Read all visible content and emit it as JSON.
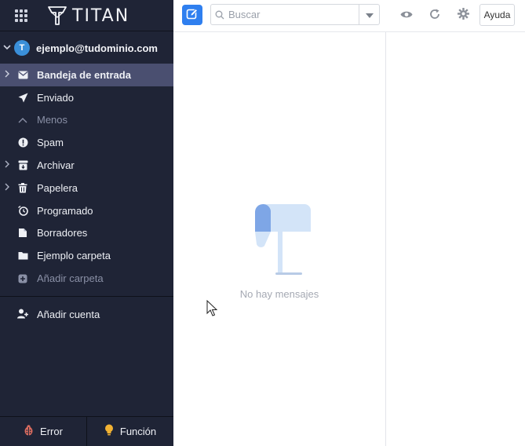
{
  "app": {
    "logo_text": "TITAN"
  },
  "account": {
    "initial": "T",
    "email": "ejemplo@tudominio.com"
  },
  "folders": [
    {
      "label": "Bandeja de entrada",
      "icon": "envelope-icon"
    },
    {
      "label": "Enviado",
      "icon": "paper-plane-icon"
    },
    {
      "label": "Menos",
      "icon": "chevron-up-icon"
    },
    {
      "label": "Spam",
      "icon": "alert-icon"
    },
    {
      "label": "Archivar",
      "icon": "archive-icon"
    },
    {
      "label": "Papelera",
      "icon": "trash-icon"
    },
    {
      "label": "Programado",
      "icon": "clock-icon"
    },
    {
      "label": "Borradores",
      "icon": "draft-icon"
    },
    {
      "label": "Ejemplo carpeta",
      "icon": "folder-icon"
    },
    {
      "label": "Añadir carpeta",
      "icon": "add-folder-icon"
    }
  ],
  "add_account_label": "Añadir cuenta",
  "footer": {
    "bug_label": "Error",
    "feature_label": "Función"
  },
  "search": {
    "placeholder": "Buscar"
  },
  "toolbar": {
    "help_label": "Ayuda"
  },
  "mail_list": {
    "empty_text": "No hay mensajes"
  },
  "colors": {
    "sidebar_bg": "#1f2436",
    "active_folder_bg": "#4a4f70",
    "accent": "#2f7fef"
  }
}
